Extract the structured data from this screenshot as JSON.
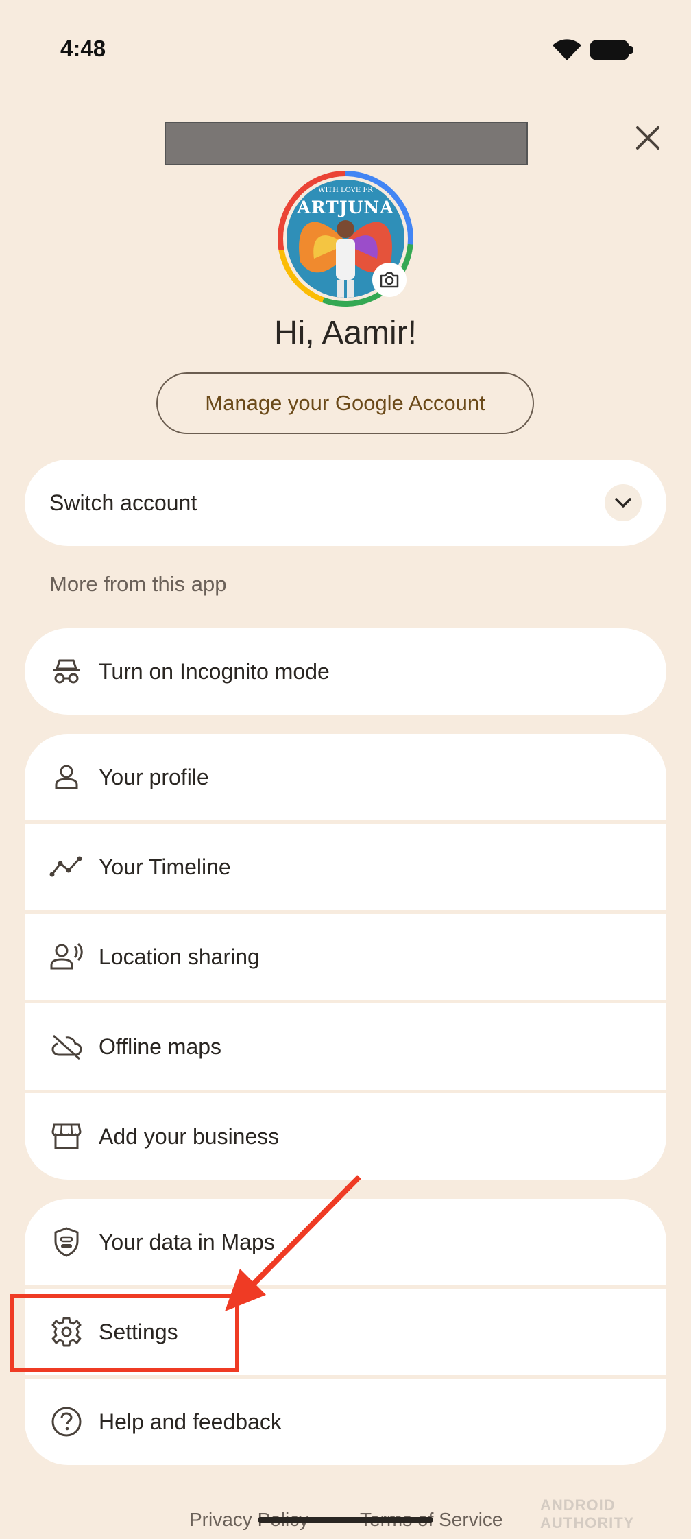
{
  "status_bar": {
    "time": "4:48"
  },
  "header": {
    "close_label": "×"
  },
  "profile": {
    "avatar_text_top": "WITH LOVE FR",
    "avatar_text": "ARTJUNA",
    "greeting": "Hi, Aamir!",
    "manage_account": "Manage your Google Account"
  },
  "switch_account": {
    "label": "Switch account"
  },
  "section": {
    "more_from_app": "More from this app"
  },
  "menu": {
    "incognito": "Turn on Incognito mode",
    "profile": "Your profile",
    "timeline": "Your Timeline",
    "location_sharing": "Location sharing",
    "offline_maps": "Offline maps",
    "add_business": "Add your business",
    "your_data": "Your data in Maps",
    "settings": "Settings",
    "help": "Help and feedback"
  },
  "footer": {
    "privacy": "Privacy Policy",
    "separator": "•",
    "terms": "Terms of Service",
    "watermark": "ANDROID AUTHORITY"
  },
  "colors": {
    "background": "#f7ebde",
    "card": "#ffffff",
    "highlight": "#ef3b24",
    "manage_text": "#6b4a1a"
  }
}
